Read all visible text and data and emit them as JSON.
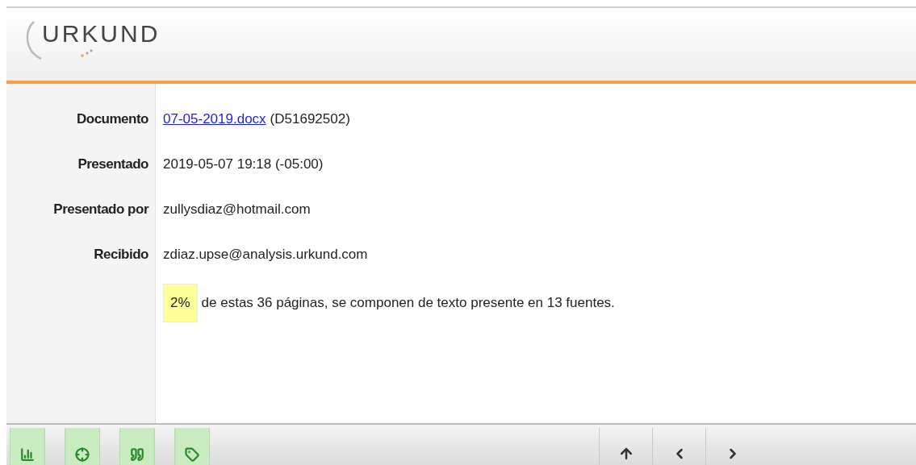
{
  "logo": {
    "text": "URKUND"
  },
  "details": [
    {
      "label": "Documento",
      "kind": "link",
      "link": "07-05-2019.docx",
      "value": "(D51692502)"
    },
    {
      "label": "Presentado",
      "kind": "text",
      "value": "2019-05-07 19:18 (-05:00)"
    },
    {
      "label": "Presentado por",
      "kind": "text",
      "value": "zullysdiaz@hotmail.com"
    },
    {
      "label": "Recibido",
      "kind": "text",
      "value": "zdiaz.upse@analysis.urkund.com"
    }
  ],
  "summary": {
    "percent": "2%",
    "text": "de estas 36 páginas, se componen de texto presente en 13 fuentes."
  }
}
